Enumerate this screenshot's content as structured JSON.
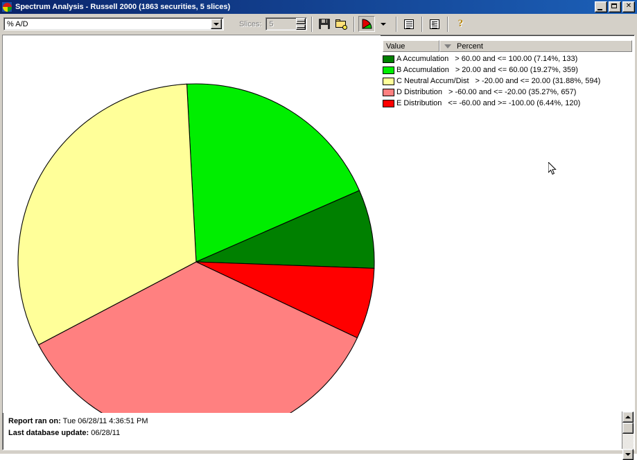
{
  "window": {
    "title": "Spectrum Analysis - Russell 2000 (1863 securities, 5 slices)",
    "icon": "pie-chart-icon",
    "minimize_label": "_",
    "maximize_label": "□",
    "close_label": "✕"
  },
  "toolbar": {
    "indicator_combo_value": "% A/D",
    "slices_label": "Slices:",
    "slices_value": "5",
    "buttons": [
      {
        "name": "save-icon",
        "label": "Save"
      },
      {
        "name": "open-folder-icon",
        "label": "Open"
      },
      {
        "name": "pie-chart-icon",
        "label": "Pie Chart"
      },
      {
        "name": "chevron-down-icon",
        "label": "Chart Type"
      },
      {
        "name": "list-report-icon",
        "label": "List"
      },
      {
        "name": "detail-report-icon",
        "label": "Detail Report"
      },
      {
        "name": "help-icon",
        "label": "?"
      }
    ]
  },
  "legend": {
    "columns": [
      "Value",
      "Percent"
    ],
    "sort_indicator": "descending",
    "rows": [
      {
        "color": "#008000",
        "name": "A Accumulation",
        "desc": "> 60.00 and <= 100.00 (7.14%, 133)"
      },
      {
        "color": "#00EE00",
        "name": "B Accumulation",
        "desc": "> 20.00 and <= 60.00 (19.27%, 359)"
      },
      {
        "color": "#FFFF99",
        "name": "C Neutral Accum/Dist",
        "desc": "> -20.00 and <= 20.00 (31.88%, 594)"
      },
      {
        "color": "#FF8080",
        "name": "D Distribution",
        "desc": "> -60.00 and <= -20.00 (35.27%, 657)"
      },
      {
        "color": "#FF0000",
        "name": "E Distribution",
        "desc": "<= -60.00 and >= -100.00 (6.44%, 120)"
      }
    ]
  },
  "footer": {
    "report_ran_label": "Report ran on:",
    "report_ran_value": "Tue 06/28/11 4:36:51 PM",
    "last_update_label": "Last database update:",
    "last_update_value": "06/28/11"
  },
  "chart_data": {
    "type": "pie",
    "title": "Spectrum Analysis - Russell 2000",
    "subtitle": "% A/D",
    "total_securities": 1863,
    "slice_count": 5,
    "start_angle_deg": 357,
    "categories": [
      "B Accumulation",
      "A Accumulation",
      "E Distribution",
      "D Distribution",
      "C Neutral Accum/Dist"
    ],
    "values": [
      19.27,
      7.14,
      6.44,
      35.27,
      31.88
    ],
    "counts": [
      359,
      133,
      120,
      657,
      594
    ],
    "colors": [
      "#00EE00",
      "#008000",
      "#FF0000",
      "#FF8080",
      "#FFFF99"
    ],
    "ranges": [
      "> 20.00 and <= 60.00",
      "> 60.00 and <= 100.00",
      "<= -60.00 and >= -100.00",
      "> -60.00 and <= -20.00",
      "> -20.00 and <= 20.00"
    ],
    "legend_position": "top-right",
    "grid": false,
    "center": [
      279,
      327
    ],
    "radius": 257
  }
}
